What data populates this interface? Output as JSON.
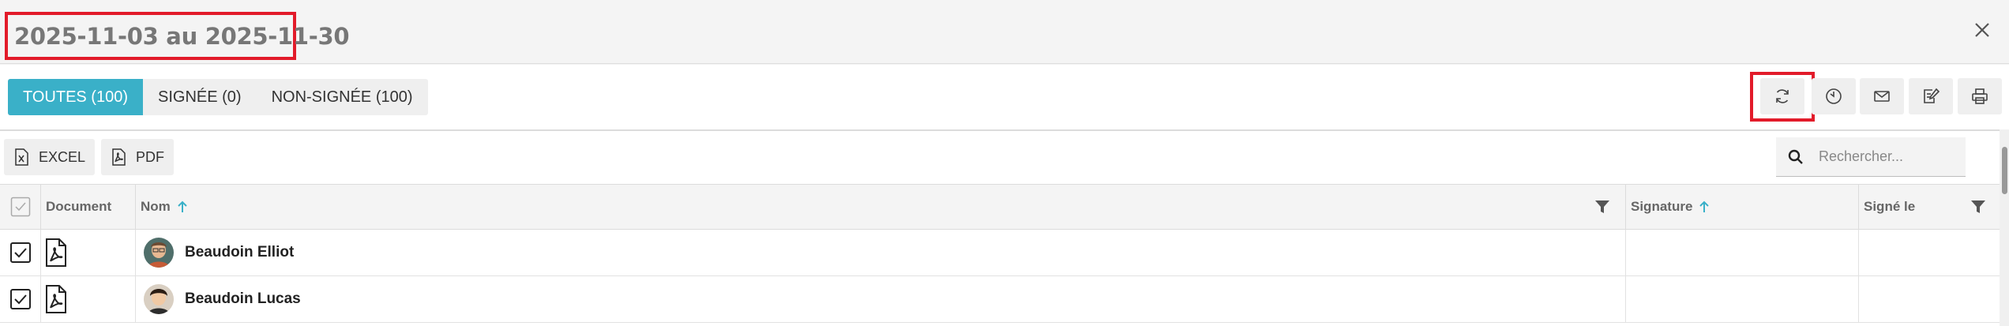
{
  "header": {
    "title": "2025-11-03 au 2025-11-30",
    "close_icon": "close-icon"
  },
  "tabs": [
    {
      "label": "TOUTES (100)",
      "active": true
    },
    {
      "label": "SIGNÉE (0)",
      "active": false
    },
    {
      "label": "NON-SIGNÉE (100)",
      "active": false
    }
  ],
  "actions": [
    {
      "name": "refresh-icon"
    },
    {
      "name": "clock-icon"
    },
    {
      "name": "mail-icon"
    },
    {
      "name": "sign-edit-icon"
    },
    {
      "name": "print-icon"
    }
  ],
  "export": {
    "excel_label": "EXCEL",
    "pdf_label": "PDF"
  },
  "search": {
    "placeholder": "Rechercher..."
  },
  "table": {
    "columns": {
      "document": "Document",
      "nom": "Nom",
      "signature": "Signature",
      "signe_le": "Signé le"
    },
    "rows": [
      {
        "name": "Beaudoin Elliot",
        "checked": true
      },
      {
        "name": "Beaudoin Lucas",
        "checked": true
      }
    ]
  },
  "colors": {
    "accent": "#3ab0c8",
    "highlight": "#e21b2a"
  }
}
